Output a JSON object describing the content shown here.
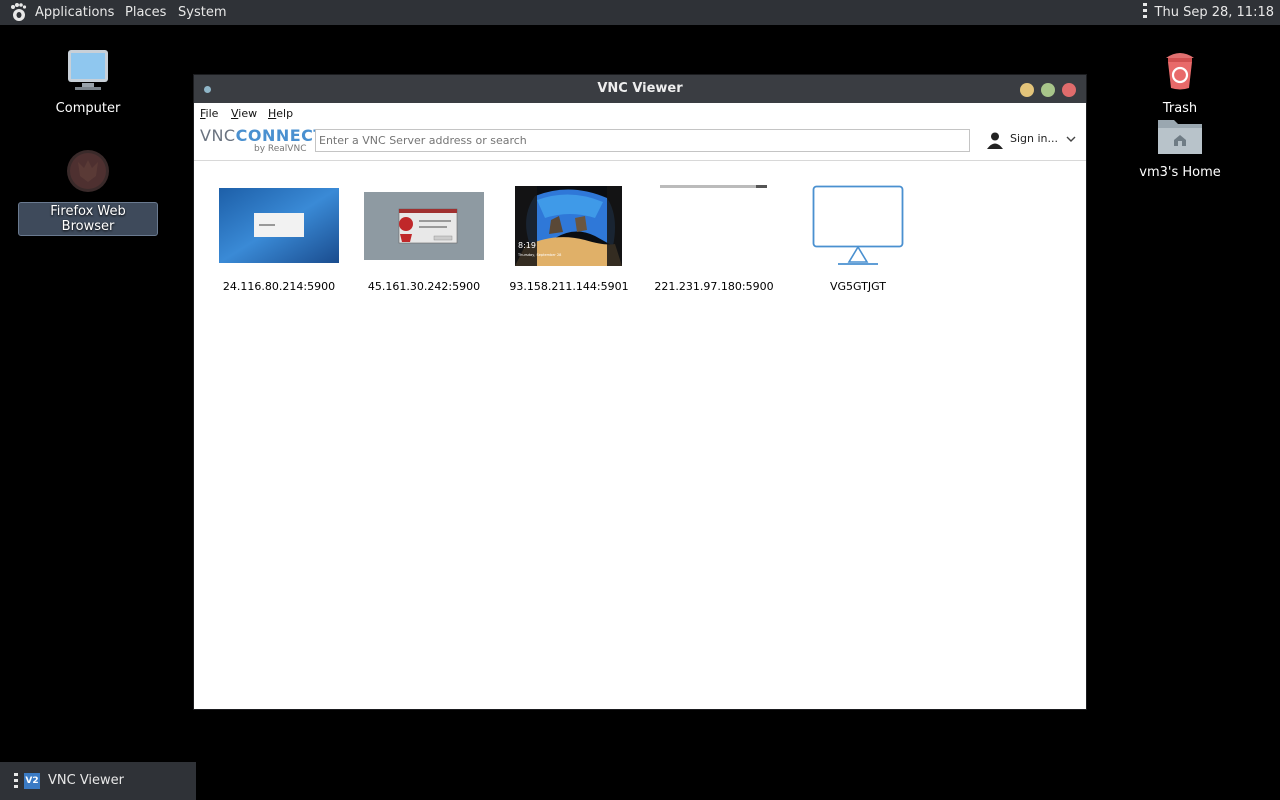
{
  "top_panel": {
    "menus": [
      "Applications",
      "Places",
      "System"
    ],
    "clock": "Thu Sep 28, 11:18"
  },
  "desktop": {
    "icons": [
      {
        "label": "Computer",
        "icon": "computer-icon"
      },
      {
        "label": "Firefox Web Browser",
        "icon": "firefox-icon"
      },
      {
        "label": "Trash",
        "icon": "trash-icon"
      },
      {
        "label": "vm3's Home",
        "icon": "home-folder-icon"
      }
    ]
  },
  "window": {
    "title": "VNC Viewer",
    "menu": [
      "File",
      "View",
      "Help"
    ],
    "logo_main": "CONNECT",
    "logo_prefix": "VNC",
    "logo_by": "by RealVNC",
    "search_placeholder": "Enter a VNC Server address or search",
    "sign_in": "Sign in...",
    "connections": [
      {
        "label": "24.116.80.214:5900",
        "thumb": "blue-desktop"
      },
      {
        "label": "45.161.30.242:5900",
        "thumb": "bsd-desktop"
      },
      {
        "label": "93.158.211.144:5901",
        "thumb": "windows-lockscreen",
        "thumb_time": "8:19",
        "thumb_date": "Thursday, September 28"
      },
      {
        "label": "221.231.97.180:5900",
        "thumb": "blank"
      },
      {
        "label": "VG5GTJGT",
        "thumb": "monitor-placeholder"
      }
    ],
    "colors": {
      "close": "#e06c6c",
      "maximize": "#a8c58a",
      "minimize": "#e3c47a",
      "accent": "#4a90d0"
    }
  },
  "taskbar": {
    "task_label": "VNC Viewer",
    "task_icon_text": "V2"
  }
}
